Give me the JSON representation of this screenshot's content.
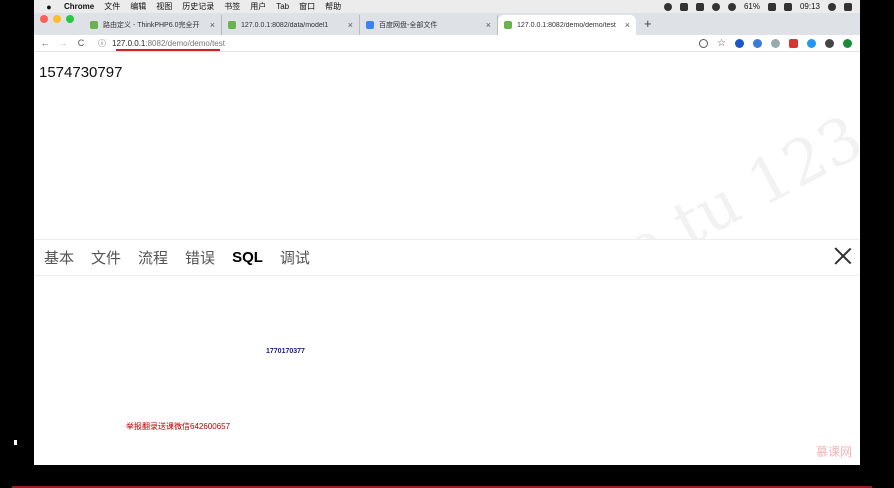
{
  "menubar": {
    "apple": "",
    "items": [
      "Chrome",
      "文件",
      "编辑",
      "视图",
      "历史记录",
      "书签",
      "用户",
      "Tab",
      "窗口",
      "帮助"
    ],
    "battery": "61%",
    "time": "09:13"
  },
  "tabs": [
    {
      "label": "路由定义 - ThinkPHP6.0完全开",
      "color": "#6bb24f"
    },
    {
      "label": "127.0.0.1:8082/data/model1",
      "color": "#6bb24f"
    },
    {
      "label": "百度网盘-全部文件",
      "color": "#3b82f6"
    },
    {
      "label": "127.0.0.1:8082/demo/demo/test",
      "color": "#6bb24f"
    }
  ],
  "toolbar": {
    "back": "←",
    "forward": "→",
    "reload": "C",
    "info": "ⓘ",
    "url_host": "127.0.0.1",
    "url_path": ":8082/demo/demo/test"
  },
  "page": {
    "timestamp": "1574730797"
  },
  "trace": {
    "tabs": [
      "基本",
      "文件",
      "流程",
      "错误",
      "SQL",
      "调试"
    ],
    "active_index": 4
  },
  "overlays": {
    "blue": "1770170377",
    "red": "举报翻录送课微信642600657"
  },
  "watermark": {
    "logo": "慕课网"
  }
}
